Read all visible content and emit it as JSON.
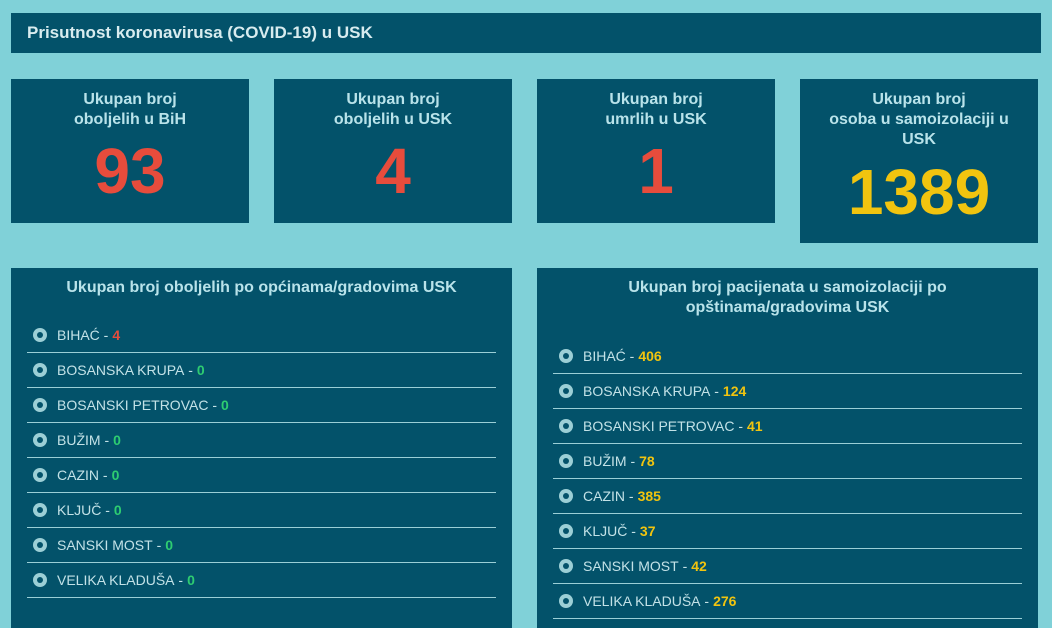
{
  "header": {
    "title": "Prisutnost koronavirusa (COVID-19) u USK"
  },
  "stats": [
    {
      "label_line1": "Ukupan broj",
      "label_line2": "oboljelih u BiH",
      "value": "93"
    },
    {
      "label_line1": "Ukupan broj",
      "label_line2": "oboljelih u USK",
      "value": "4"
    },
    {
      "label_line1": "Ukupan broj",
      "label_line2": "umrlih u USK",
      "value": "1"
    },
    {
      "label_line1": "Ukupan broj",
      "label_line2": "osoba u samoizolaciji u USK",
      "value": "1389"
    }
  ],
  "infected_panel": {
    "title": "Ukupan broj oboljelih po općinama/gradovima USK",
    "items": [
      {
        "name": "BIHAĆ",
        "value": "4"
      },
      {
        "name": "BOSANSKA KRUPA",
        "value": "0"
      },
      {
        "name": "BOSANSKI PETROVAC",
        "value": "0"
      },
      {
        "name": "BUŽIM",
        "value": "0"
      },
      {
        "name": "CAZIN",
        "value": "0"
      },
      {
        "name": "KLJUČ",
        "value": "0"
      },
      {
        "name": "SANSKI MOST",
        "value": "0"
      },
      {
        "name": "VELIKA KLADUŠA",
        "value": "0"
      }
    ]
  },
  "isolation_panel": {
    "title": "Ukupan broj pacijenata u samoizolaciji po opštinama/gradovima USK",
    "items": [
      {
        "name": "BIHAĆ",
        "value": "406"
      },
      {
        "name": "BOSANSKA KRUPA",
        "value": "124"
      },
      {
        "name": "BOSANSKI PETROVAC",
        "value": "41"
      },
      {
        "name": "BUŽIM",
        "value": "78"
      },
      {
        "name": "CAZIN",
        "value": "385"
      },
      {
        "name": "KLJUČ",
        "value": "37"
      },
      {
        "name": "SANSKI MOST",
        "value": "42"
      },
      {
        "name": "VELIKA KLADUŠA",
        "value": "276"
      }
    ]
  },
  "colors": {
    "background": "#80d1d8",
    "panel": "#03526a",
    "red": "#e74c3c",
    "yellow": "#f1c40f",
    "green": "#2ecc71"
  },
  "icons": {
    "list_bullet": "circle-bullet-icon"
  }
}
